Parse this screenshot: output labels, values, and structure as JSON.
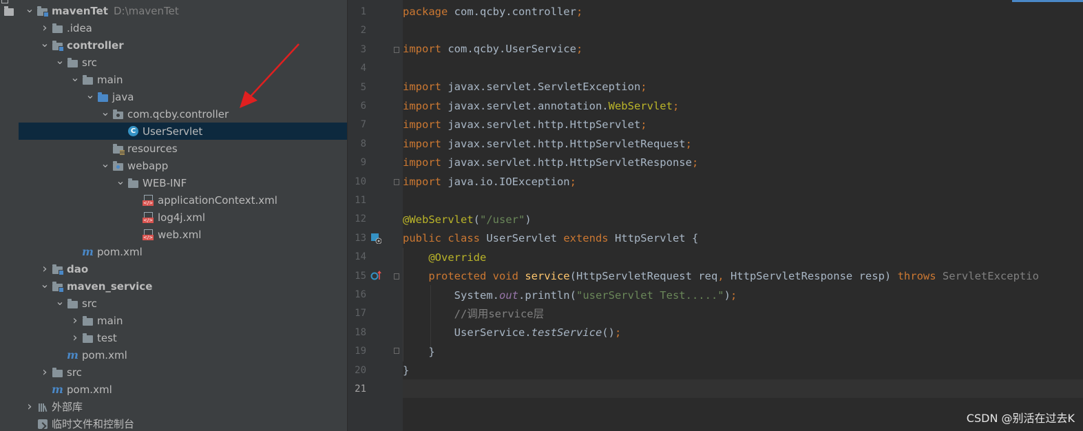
{
  "project_tree": [
    {
      "label": "mavenTet",
      "suffix": "D:\\mavenTet",
      "arrow": "down",
      "icon": "module-folder-icon",
      "bold": true
    },
    {
      "label": ".idea",
      "arrow": "right",
      "icon": "folder-icon"
    },
    {
      "label": "controller",
      "arrow": "down",
      "icon": "module-folder-icon",
      "bold": true
    },
    {
      "label": "src",
      "arrow": "down",
      "icon": "folder-icon"
    },
    {
      "label": "main",
      "arrow": "down",
      "icon": "folder-icon"
    },
    {
      "label": "java",
      "arrow": "down",
      "icon": "source-folder-icon"
    },
    {
      "label": "com.qcby.controller",
      "arrow": "down",
      "icon": "package-icon"
    },
    {
      "label": "UserServlet",
      "arrow": "none",
      "icon": "class-icon",
      "selected": true
    },
    {
      "label": "resources",
      "arrow": "none",
      "icon": "resources-folder-icon"
    },
    {
      "label": "webapp",
      "arrow": "down",
      "icon": "web-folder-icon"
    },
    {
      "label": "WEB-INF",
      "arrow": "down",
      "icon": "folder-icon"
    },
    {
      "label": "applicationContext.xml",
      "arrow": "none",
      "icon": "xml-file-icon"
    },
    {
      "label": "log4j.xml",
      "arrow": "none",
      "icon": "xml-file-icon"
    },
    {
      "label": "web.xml",
      "arrow": "none",
      "icon": "xml-file-icon"
    },
    {
      "label": "pom.xml",
      "arrow": "none",
      "icon": "maven-icon"
    },
    {
      "label": "dao",
      "arrow": "right",
      "icon": "module-folder-icon",
      "bold": true
    },
    {
      "label": "maven_service",
      "arrow": "down",
      "icon": "module-folder-icon",
      "bold": true
    },
    {
      "label": "src",
      "arrow": "down",
      "icon": "folder-icon"
    },
    {
      "label": "main",
      "arrow": "right",
      "icon": "folder-icon"
    },
    {
      "label": "test",
      "arrow": "right",
      "icon": "folder-icon"
    },
    {
      "label": "pom.xml",
      "arrow": "none",
      "icon": "maven-icon"
    },
    {
      "label": "src",
      "arrow": "right",
      "icon": "folder-icon"
    },
    {
      "label": "pom.xml",
      "arrow": "none",
      "icon": "maven-icon"
    },
    {
      "label": "外部库",
      "arrow": "right",
      "icon": "library-icon"
    },
    {
      "label": "临时文件和控制台",
      "arrow": "none",
      "icon": "scratches-icon"
    }
  ],
  "line_numbers": [
    "1",
    "2",
    "3",
    "4",
    "5",
    "6",
    "7",
    "8",
    "9",
    "10",
    "11",
    "12",
    "13",
    "14",
    "15",
    "16",
    "17",
    "18",
    "19",
    "20",
    "21"
  ],
  "current_line": "21",
  "code": {
    "l1": {
      "a": "package ",
      "b": "com.qcby.controller",
      "c": ";"
    },
    "l3": {
      "a": "import ",
      "b": "com.qcby.UserService",
      "c": ";"
    },
    "l5": {
      "a": "import ",
      "b": "javax.servlet.ServletException",
      "c": ";"
    },
    "l6": {
      "a": "import ",
      "b": "javax.servlet.annotation.",
      "c": "WebServlet",
      "d": ";"
    },
    "l7": {
      "a": "import ",
      "b": "javax.servlet.http.HttpServlet",
      "c": ";"
    },
    "l8": {
      "a": "import ",
      "b": "javax.servlet.http.HttpServletRequest",
      "c": ";"
    },
    "l9": {
      "a": "import ",
      "b": "javax.servlet.http.HttpServletResponse",
      "c": ";"
    },
    "l10": {
      "a": "import ",
      "b": "java.io.IOException",
      "c": ";"
    },
    "l12": {
      "a": "@WebServlet",
      "b": "(",
      "c": "\"/user\"",
      "d": ")"
    },
    "l13": {
      "a": "public class ",
      "b": "UserServlet ",
      "c": "extends ",
      "d": "HttpServlet {"
    },
    "l14": {
      "a": "    @Override"
    },
    "l15": {
      "a": "    protected void ",
      "b": "service",
      "c": "(HttpServletRequest req",
      "d": ", ",
      "e": "HttpServletResponse resp) ",
      "f": "throws ",
      "g": "ServletExceptio"
    },
    "l16": {
      "a": "        System.",
      "b": "out",
      "c": ".println(",
      "d": "\"userServlet Test.....\"",
      "e": ")",
      "f": ";"
    },
    "l17": {
      "a": "        //调用service层"
    },
    "l18": {
      "a": "        UserService.",
      "b": "testService",
      "c": "()",
      "d": ";"
    },
    "l19": {
      "a": "    }"
    },
    "l20": {
      "a": "}"
    }
  },
  "watermark": "CSDN @别活在过去K",
  "colors": {
    "selection": "#0d293e",
    "keyword": "#cc7832",
    "annotation": "#bbb529",
    "string": "#6a8759",
    "function": "#ffc66d",
    "annotation_arrow": "#e02020"
  }
}
